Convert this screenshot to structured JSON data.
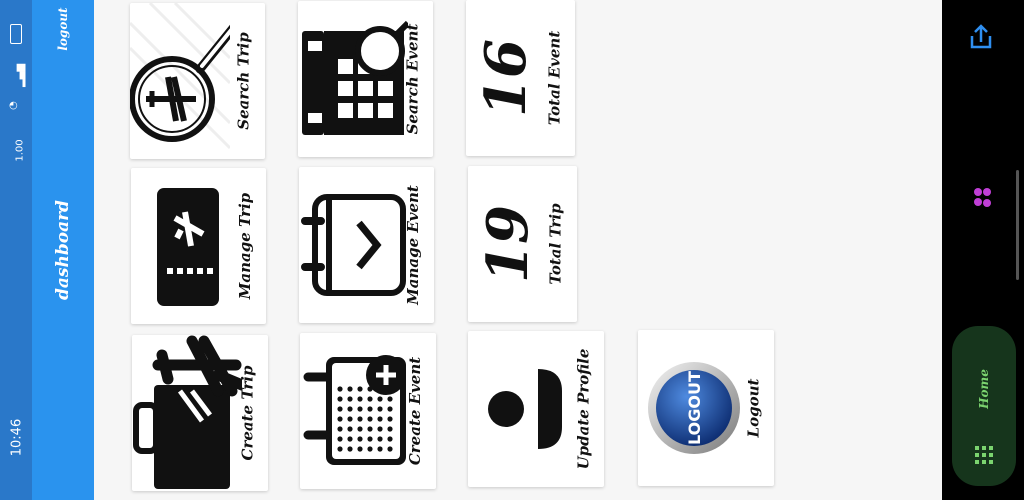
{
  "status_bar": {
    "time": "10:46",
    "speed": "1.00"
  },
  "appbar": {
    "logout": "logout",
    "title": "dashboard"
  },
  "tiles": {
    "search_trip": "Search Trip",
    "search_event": "Search Event",
    "total_event": {
      "label": "Total Event",
      "value": "16"
    },
    "manage_trip": "Manage Trip",
    "manage_event": "Manage Event",
    "total_trip": {
      "label": "Total Trip",
      "value": "19"
    },
    "create_trip": "Create Trip",
    "create_event": "Create Event",
    "update_profile": "Update Profile",
    "logout": {
      "label": "Logout",
      "badge": "LOGOUT"
    }
  },
  "nav": {
    "home": "Home"
  },
  "colors": {
    "appbar": "#2a93ee",
    "status": "#2a78c9",
    "rail": "#000000",
    "home_pill": "#16351c",
    "home_text": "#7bd36f",
    "share_icon": "#2f8ff0",
    "mid_icon": "#c03fd6"
  }
}
